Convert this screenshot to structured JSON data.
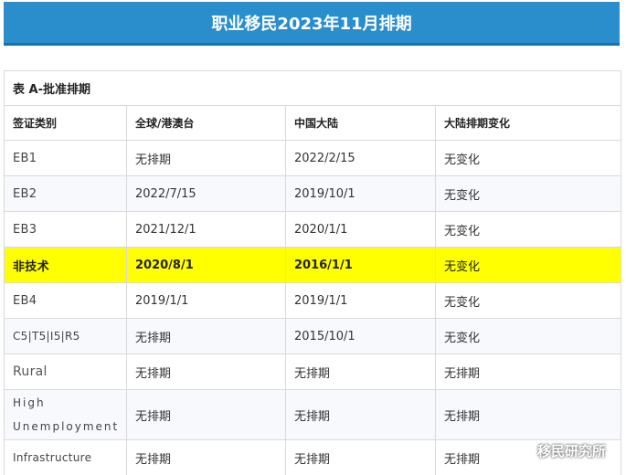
{
  "title": "职业移民2023年11月排期",
  "table": {
    "caption": "表 A-批准排期",
    "headers": [
      "签证类别",
      "全球/港澳台",
      "中国大陆",
      "大陆排期变化"
    ],
    "rows": [
      {
        "category": "EB1",
        "global": "无排期",
        "china": "2022/2/15",
        "change": "无变化"
      },
      {
        "category": "EB2",
        "global": "2022/7/15",
        "china": "2019/10/1",
        "change": "无变化"
      },
      {
        "category": "EB3",
        "global": "2021/12/1",
        "china": "2020/1/1",
        "change": "无变化"
      },
      {
        "category": "非技术",
        "global": "2020/8/1",
        "china": "2016/1/1",
        "change": "无变化"
      },
      {
        "category": "EB4",
        "global": "2019/1/1",
        "china": "2019/1/1",
        "change": "无变化"
      },
      {
        "category": "C5|T5|I5|R5",
        "global": "无排期",
        "china": "2015/10/1",
        "change": "无变化"
      },
      {
        "category": "Rural",
        "global": "无排期",
        "china": "无排期",
        "change": "无排期"
      },
      {
        "category": "High Unemployment",
        "global": "无排期",
        "china": "无排期",
        "change": "无排期"
      },
      {
        "category": "Infrastructure",
        "global": "无排期",
        "china": "无排期",
        "change": "无排期"
      }
    ]
  },
  "watermark": {
    "text": "移民研究所",
    "icon": "wechat-icon"
  },
  "colors": {
    "title_bg": "#2a8dcc",
    "highlight": "#ffff00"
  }
}
